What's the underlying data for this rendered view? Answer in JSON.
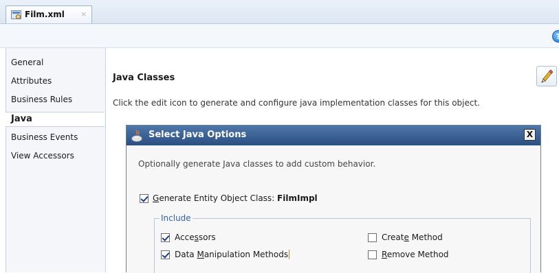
{
  "tab": {
    "title": "Film.xml",
    "close": "×",
    "file_icon": "xml-file-icon"
  },
  "toolbar": {
    "help": "?"
  },
  "sidebar": {
    "items": [
      {
        "label": "General"
      },
      {
        "label": "Attributes"
      },
      {
        "label": "Business Rules"
      },
      {
        "label": "Java",
        "selected": true
      },
      {
        "label": "Business Events"
      },
      {
        "label": "View Accessors"
      }
    ]
  },
  "main": {
    "section_title": "Java Classes",
    "description": "Click the edit icon to generate and configure java implementation classes for this object.",
    "edit_icon": "pencil-icon"
  },
  "dialog": {
    "title": "Select Java Options",
    "close": "X",
    "description": "Optionally generate Java classes to add custom behavior.",
    "generate": {
      "checked": true,
      "label_pre": "",
      "label_mn": "G",
      "label_post": "enerate Entity Object Class: ",
      "class_name": "FilmImpl"
    },
    "include": {
      "legend": "Include",
      "options": [
        {
          "pre": "Acce",
          "mn": "s",
          "post": "sors",
          "checked": true
        },
        {
          "pre": "Data ",
          "mn": "M",
          "post": "anipulation Methods",
          "checked": true
        },
        {
          "pre": "Creat",
          "mn": "e",
          "post": " Method",
          "checked": false
        },
        {
          "pre": "",
          "mn": "R",
          "post": "emove Method",
          "checked": false
        }
      ]
    }
  },
  "colors": {
    "titlebar": "#2b4f82",
    "accent_blue": "#2f5fa8"
  }
}
